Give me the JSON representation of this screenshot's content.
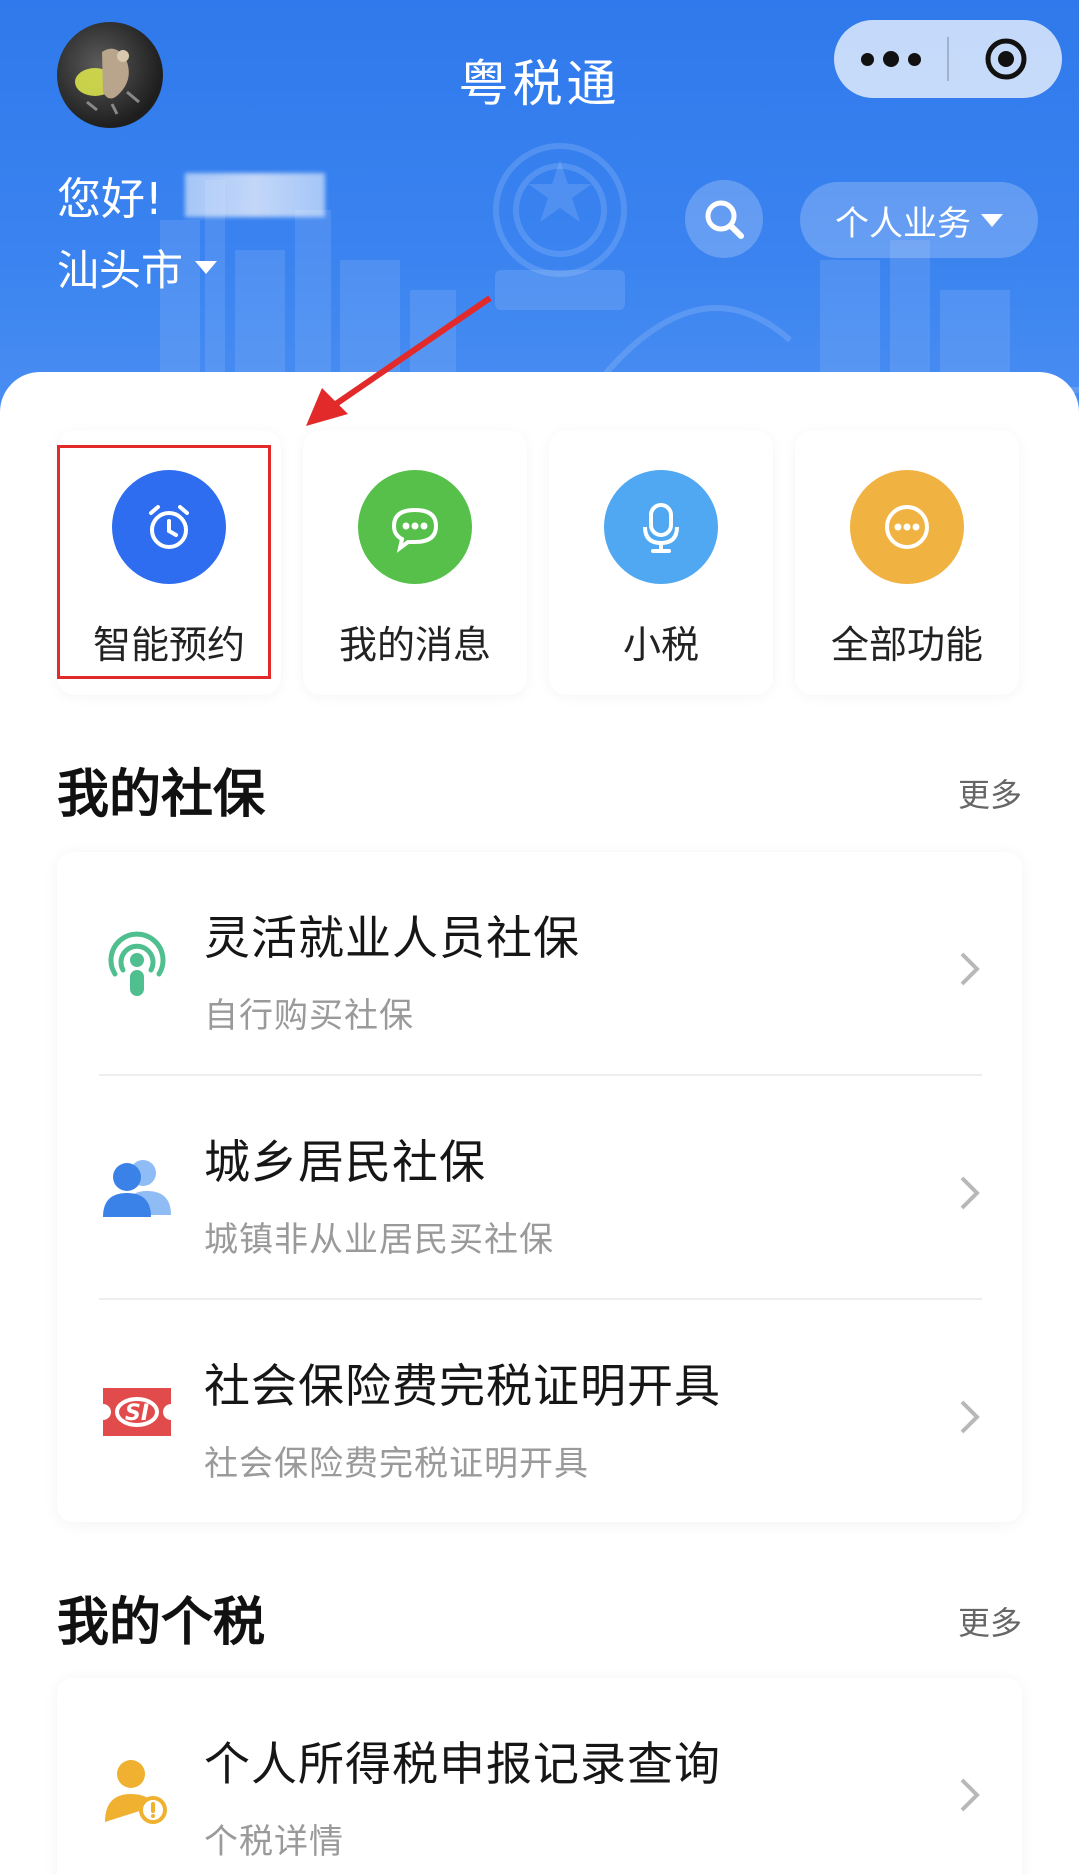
{
  "header": {
    "app_title": "粤税通",
    "greeting": "您好!",
    "city": "汕头市",
    "business_button": "个人业务",
    "bg_color": "#3580ee"
  },
  "quick_actions": [
    {
      "label": "智能预约",
      "icon": "alarm-clock-icon",
      "color": "#2f6df0",
      "highlighted": true
    },
    {
      "label": "我的消息",
      "icon": "chat-bubble-icon",
      "color": "#56c04a"
    },
    {
      "label": "小税",
      "icon": "microphone-icon",
      "color": "#4fa8f1"
    },
    {
      "label": "全部功能",
      "icon": "more-dots-icon",
      "color": "#f0b240"
    }
  ],
  "social_insurance": {
    "title": "我的社保",
    "more": "更多",
    "items": [
      {
        "title": "灵活就业人员社保",
        "subtitle": "自行购买社保",
        "icon": "broadcast-person-icon",
        "icon_color": "#4fbf8f"
      },
      {
        "title": "城乡居民社保",
        "subtitle": "城镇非从业居民买社保",
        "icon": "users-icon",
        "icon_color": "#3b82e8"
      },
      {
        "title": "社会保险费完税证明开具",
        "subtitle": "社会保险费完税证明开具",
        "icon": "si-ticket-icon",
        "icon_color": "#e24b4b"
      }
    ]
  },
  "personal_tax": {
    "title": "我的个税",
    "more": "更多",
    "items": [
      {
        "title": "个人所得税申报记录查询",
        "subtitle": "个税详情",
        "icon": "person-search-icon",
        "icon_color": "#f0b030"
      }
    ]
  }
}
